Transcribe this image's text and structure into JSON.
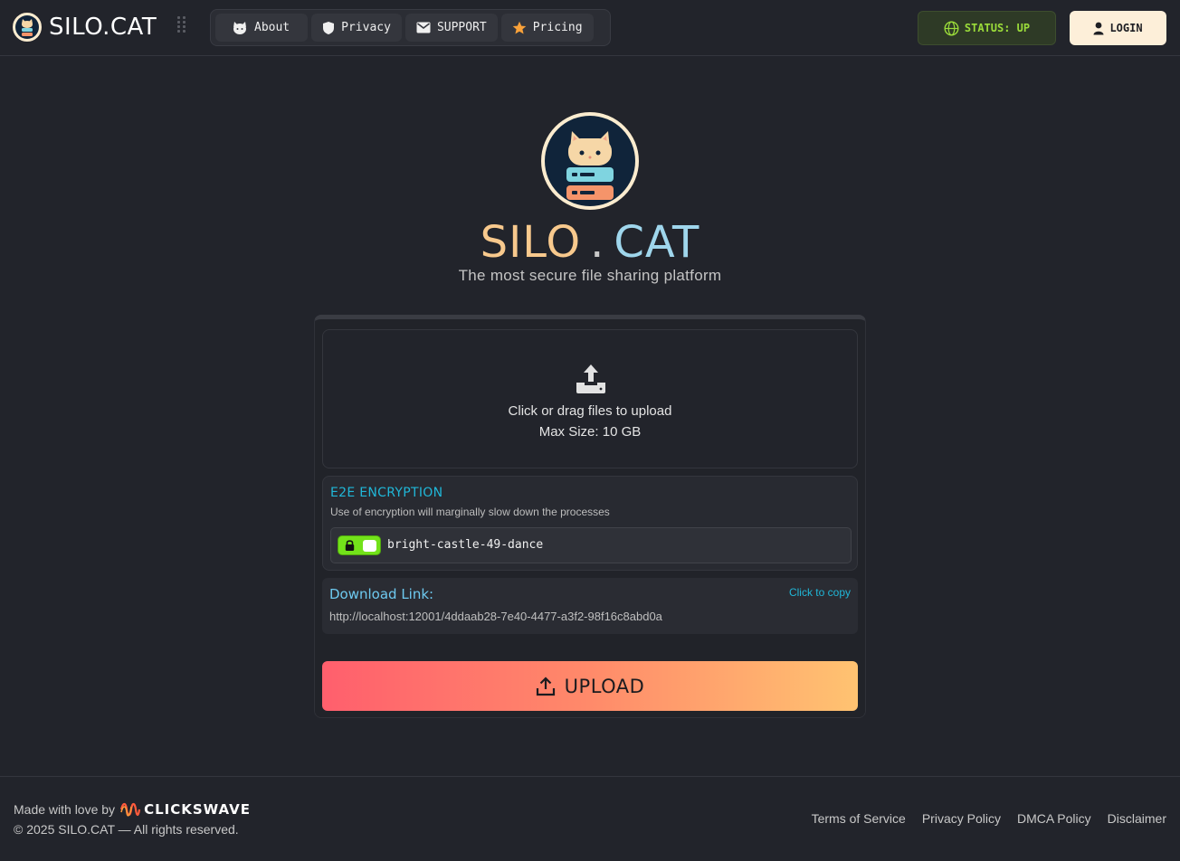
{
  "header": {
    "brand": "SILO.CAT",
    "nav": [
      {
        "label": "About",
        "icon": "cat-icon"
      },
      {
        "label": "Privacy",
        "icon": "shield-icon"
      },
      {
        "label": "SUPPORT",
        "icon": "mail-icon"
      },
      {
        "label": "Pricing",
        "icon": "star-icon"
      }
    ],
    "status_label": "STATUS: UP",
    "login_label": "LOGIN"
  },
  "hero": {
    "title_left": "SILO",
    "title_dot": ".",
    "title_right": "CAT",
    "subtitle": "The most secure file sharing platform"
  },
  "upload": {
    "drop_text": "Click or drag files to upload",
    "max_size": "Max Size: 10 GB",
    "encryption": {
      "title": "E2E ENCRYPTION",
      "description": "Use of encryption will marginally slow down the processes",
      "enabled": true,
      "passphrase": "bright-castle-49-dance"
    },
    "download": {
      "label": "Download Link:",
      "copy_label": "Click to copy",
      "url": "http://localhost:12001/4ddaab28-7e40-4477-a3f2-98f16c8abd0a"
    },
    "button_label": "UPLOAD"
  },
  "footer": {
    "made_with": "Made with love by",
    "company": "CLICKSWAVE",
    "copyright": "© 2025 SILO.CAT — All rights reserved.",
    "links": [
      "Terms of Service",
      "Privacy Policy",
      "DMCA Policy",
      "Disclaimer"
    ]
  },
  "colors": {
    "background": "#22242b",
    "accent_cyan": "#20b7d8",
    "status_green": "#9bdc3a",
    "toggle_green": "#73e21a",
    "upload_gradient_start": "#ff5f6d",
    "upload_gradient_end": "#ffc371"
  }
}
